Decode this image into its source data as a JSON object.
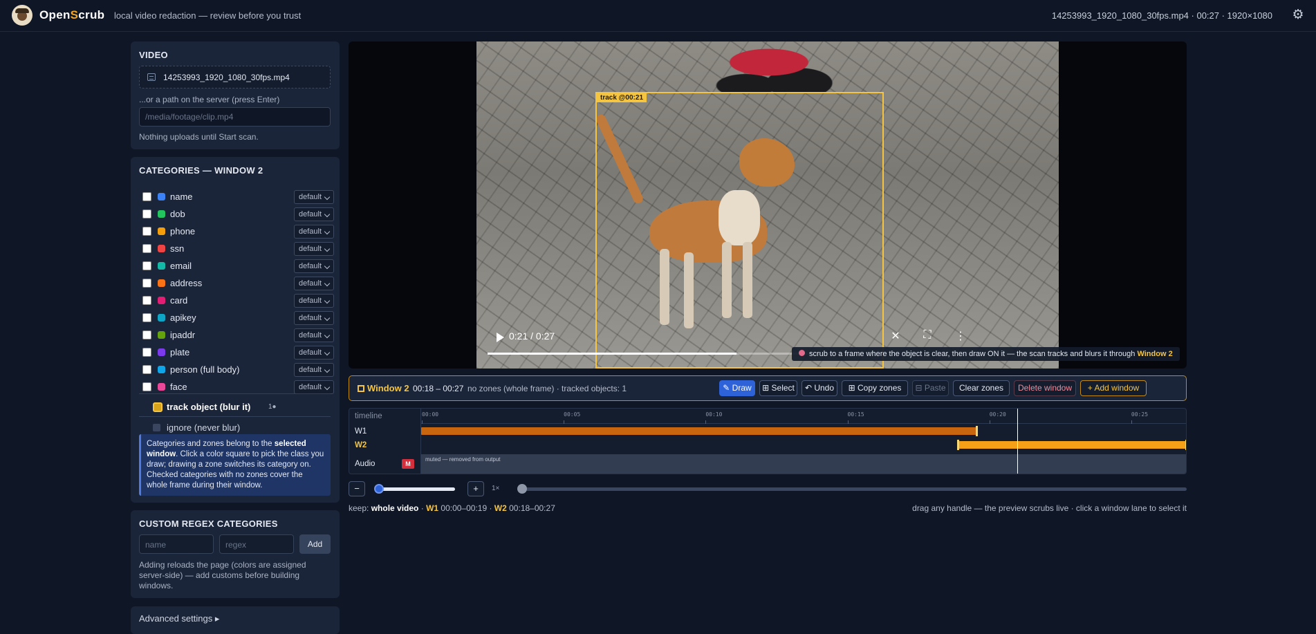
{
  "app": {
    "brand_a": "Open",
    "brand_o": "S",
    "brand_b": "crub",
    "tagline": "local video redaction — review before you trust",
    "fileinfo": "14253993_1920_1080_30fps.mp4 · 00:27 · 1920×1080"
  },
  "video_panel": {
    "title": "VIDEO",
    "filename": "14253993_1920_1080_30fps.mp4",
    "path_label": "...or a path on the server (press Enter)",
    "path_placeholder": "/media/footage/clip.mp4",
    "note": "Nothing uploads until Start scan."
  },
  "categories": {
    "title": "CATEGORIES — WINDOW 2",
    "items": [
      {
        "label": "name",
        "color": "#3b82f6",
        "mode": "default"
      },
      {
        "label": "dob",
        "color": "#22c55e",
        "mode": "default"
      },
      {
        "label": "phone",
        "color": "#f59e0b",
        "mode": "default"
      },
      {
        "label": "ssn",
        "color": "#ef4444",
        "mode": "default"
      },
      {
        "label": "email",
        "color": "#14b8a6",
        "mode": "default"
      },
      {
        "label": "address",
        "color": "#f97316",
        "mode": "default"
      },
      {
        "label": "card",
        "color": "#e11d74",
        "mode": "default"
      },
      {
        "label": "apikey",
        "color": "#0ea5c6",
        "mode": "default"
      },
      {
        "label": "ipaddr",
        "color": "#65a30d",
        "mode": "default"
      },
      {
        "label": "plate",
        "color": "#7c3aed",
        "mode": "default"
      },
      {
        "label": "person (full body)",
        "color": "#0ea5e9",
        "mode": "default"
      },
      {
        "label": "face",
        "color": "#ec4899",
        "mode": "default"
      }
    ],
    "track_label": "track object (blur it)",
    "track_count": "1●",
    "ignore_label": "ignore (never blur)",
    "info_a": "Categories and zones belong to the ",
    "info_b": "selected window",
    "info_c": ". Click a color square to pick the class you draw; drawing a zone switches its category on. Checked categories with no zones cover the whole frame during their window."
  },
  "regex": {
    "title": "CUSTOM REGEX CATEGORIES",
    "name_placeholder": "name",
    "regex_placeholder": "regex",
    "add": "Add",
    "note": "Adding reloads the page (colors are assigned server-side) — add customs before building windows."
  },
  "advanced": {
    "label": "Advanced settings ▸"
  },
  "player": {
    "track_label": "track @00:21",
    "timecode": "0:21 / 0:27",
    "hint_a": "scrub to a frame where the object is clear, then draw ON it — the scan tracks and blurs it through ",
    "hint_b": "Window 2"
  },
  "window_bar": {
    "title": "Window 2",
    "time": "00:18 – 00:27",
    "info": "no zones (whole frame) · tracked objects: 1",
    "draw": "✎ Draw",
    "select": "⊞ Select",
    "undo": "↶ Undo",
    "copy": "⊞ Copy zones",
    "paste": "⊟ Paste",
    "clear": "Clear zones",
    "delete": "Delete window",
    "add": "+ Add window"
  },
  "timeline": {
    "label": "timeline",
    "w1": "W1",
    "w2": "W2",
    "audio": "Audio",
    "mute_badge": "M",
    "audio_note": "muted — removed from output",
    "ticks": [
      "00:00",
      "00:05",
      "00:10",
      "00:15",
      "00:20",
      "00:25"
    ],
    "duration_s": 27,
    "w1_range": [
      0,
      19.6
    ],
    "w2_range": [
      18.9,
      27
    ],
    "playhead_s": 21
  },
  "zoom": {
    "minus": "−",
    "plus": "+",
    "label": "1×"
  },
  "keep": {
    "a": "keep: ",
    "b": "whole video",
    "c": " · ",
    "w1": "W1",
    "w1t": " 00:00–00:19 · ",
    "w2": "W2",
    "w2t": " 00:18–00:27"
  },
  "drag_note": "drag any handle — the preview scrubs live · click a window lane to select it"
}
